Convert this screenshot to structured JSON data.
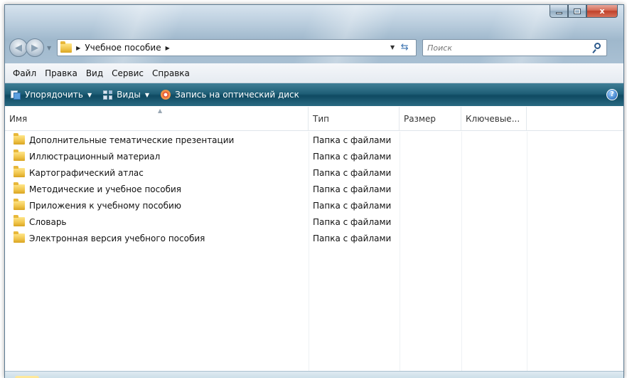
{
  "window": {
    "caption_buttons": {
      "minimize_icon": "minimize-icon",
      "maximize_icon": "maximize-icon",
      "close_glyph": "x"
    }
  },
  "navigation": {
    "back_glyph": "◀",
    "forward_glyph": "▶",
    "address": {
      "breadcrumb": "Учебное пособие"
    },
    "search": {
      "placeholder": "Поиск"
    }
  },
  "menubar": {
    "items": [
      "Файл",
      "Правка",
      "Вид",
      "Сервис",
      "Справка"
    ]
  },
  "commandbar": {
    "organize": "Упорядочить",
    "views": "Виды",
    "burn": "Запись на оптический диск",
    "help_glyph": "?"
  },
  "columns": {
    "name": "Имя",
    "type": "Тип",
    "size": "Размер",
    "keywords": "Ключевые..."
  },
  "files": [
    {
      "name": "Дополнительные тематические презентации",
      "type": "Папка с файлами"
    },
    {
      "name": "Иллюстрационный материал",
      "type": "Папка с файлами"
    },
    {
      "name": "Картографический атлас",
      "type": "Папка с файлами"
    },
    {
      "name": "Методические и учебное пособия",
      "type": "Папка с файлами"
    },
    {
      "name": "Приложения к учебному пособию",
      "type": "Папка с файлами"
    },
    {
      "name": "Словарь",
      "type": "Папка с файлами"
    },
    {
      "name": "Электронная версия учебного пособия",
      "type": "Папка с файлами"
    }
  ],
  "colors": {
    "command_bar": "#1f5f77",
    "glass": "#b7cbdc",
    "close_button": "#c0412a",
    "folder": "#f0c44a"
  }
}
